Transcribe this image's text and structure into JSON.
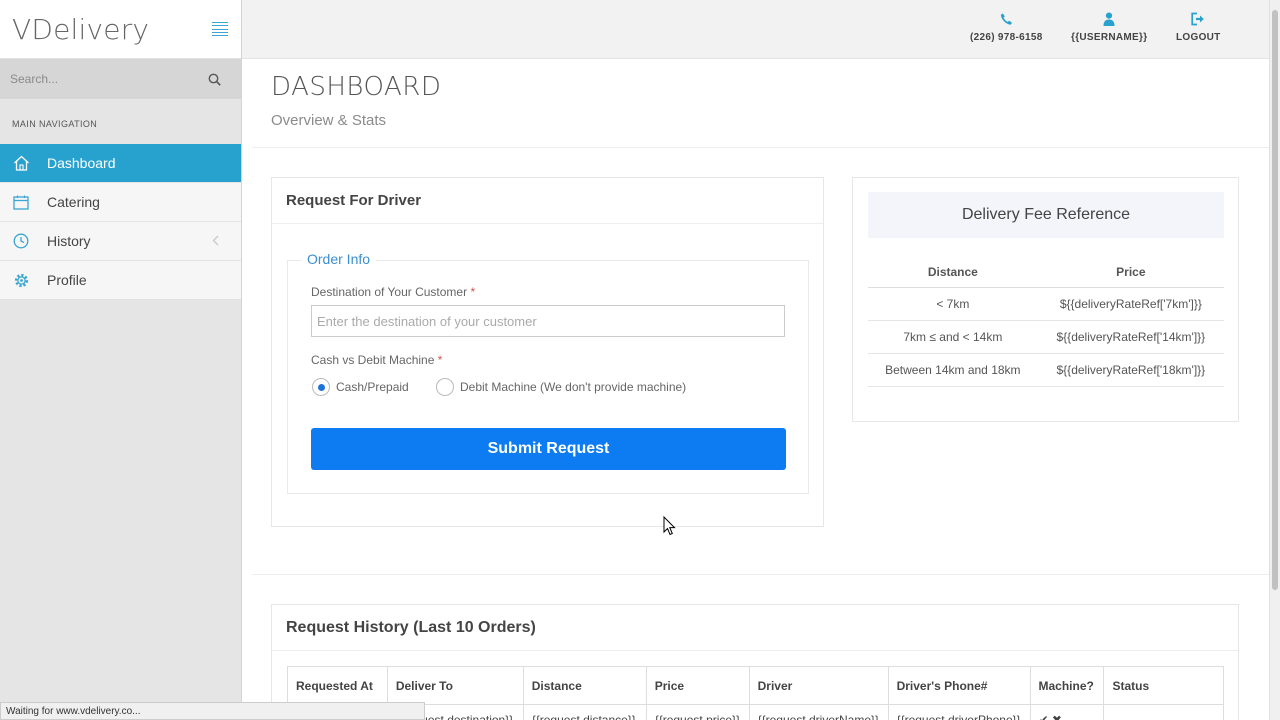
{
  "sidebar": {
    "logo": "VDelivery",
    "search_placeholder": "Search...",
    "nav_heading": "MAIN NAVIGATION",
    "items": [
      {
        "label": "Dashboard",
        "icon": "home-icon",
        "active": true
      },
      {
        "label": "Catering",
        "icon": "calendar-icon",
        "active": false
      },
      {
        "label": "History",
        "icon": "clock-icon",
        "active": false
      },
      {
        "label": "Profile",
        "icon": "gear-icon",
        "active": false
      }
    ]
  },
  "header": {
    "phone": "(226) 978-6158",
    "username": "{{USERNAME}}",
    "logout": "LOGOUT"
  },
  "page": {
    "title": "DASHBOARD",
    "subtitle": "Overview & Stats"
  },
  "request_form": {
    "title": "Request For Driver",
    "legend": "Order Info",
    "destination_label": "Destination of Your Customer",
    "required_mark": "*",
    "destination_placeholder": "Enter the destination of your customer",
    "destination_value": "",
    "payment_label": "Cash vs Debit Machine",
    "options": [
      {
        "label": "Cash/Prepaid",
        "selected": true
      },
      {
        "label": "Debit Machine (We don't provide machine)",
        "selected": false
      }
    ],
    "submit_label": "Submit Request"
  },
  "fee_reference": {
    "title": "Delivery Fee Reference",
    "columns": [
      "Distance",
      "Price"
    ],
    "rows": [
      [
        "< 7km",
        "${{deliveryRateRef['7km']}}"
      ],
      [
        "7km ≤ and < 14km",
        "${{deliveryRateRef['14km']}}"
      ],
      [
        "Between 14km and 18km",
        "${{deliveryRateRef['18km']}}"
      ]
    ]
  },
  "history": {
    "title": "Request History (Last 10 Orders)",
    "columns": [
      "Requested At",
      "Deliver To",
      "Distance",
      "Price",
      "Driver",
      "Driver's Phone#",
      "Machine?",
      "Status"
    ],
    "row": [
      "",
      "{{request.destination}}",
      "{{request.distance}}",
      "{{request.price}}",
      "{{request.driverName}}",
      "{{request.driverPhone}}",
      "✔ ✖",
      ""
    ]
  },
  "status_bar": "Waiting for www.vdelivery.co...",
  "colors": {
    "accent": "#27a1cd",
    "submit": "#0d7bf1",
    "legend": "#3a8fd0"
  }
}
